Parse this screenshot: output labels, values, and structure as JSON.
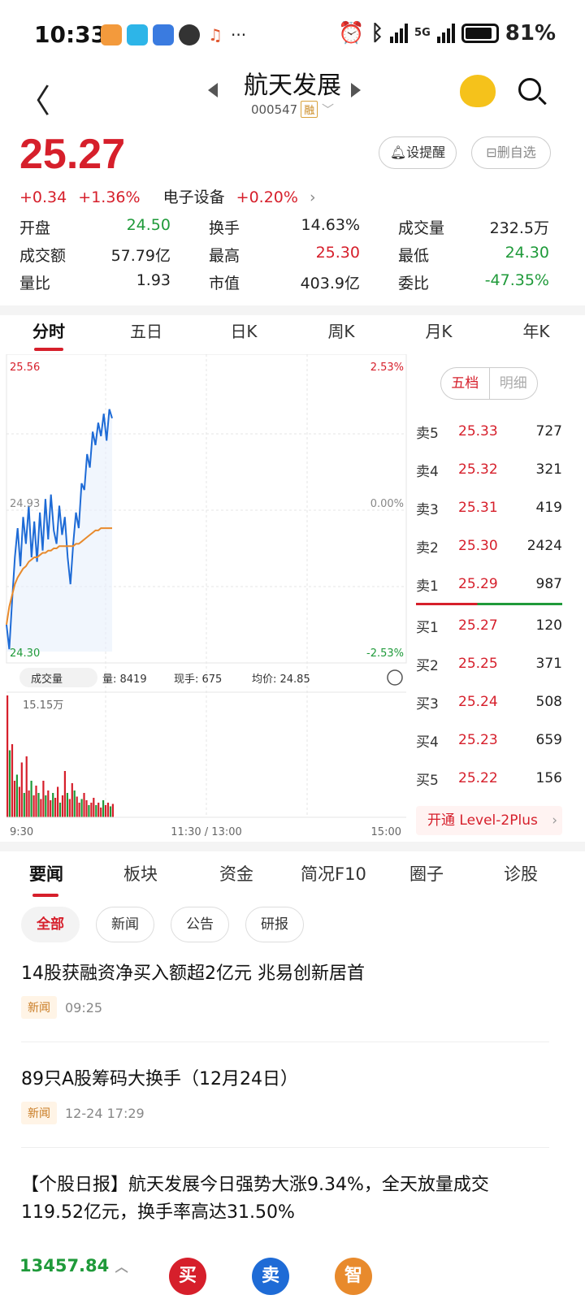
{
  "status": {
    "time": "10:33",
    "battery": "81%",
    "net": "5G"
  },
  "header": {
    "title": "航天发展",
    "code": "000547",
    "tag": "融"
  },
  "quote": {
    "price": "25.27",
    "change": "+0.34",
    "change_pct": "+1.36%",
    "sector": "电子设备",
    "sector_pct": "+0.20%",
    "remind": "设提醒",
    "unwatch": "删自选",
    "stats": [
      [
        {
          "l": "开盘",
          "v": "24.50",
          "c": "green"
        },
        {
          "l": "换手",
          "v": "14.63%",
          "c": ""
        },
        {
          "l": "成交量",
          "v": "232.5万",
          "c": ""
        }
      ],
      [
        {
          "l": "成交额",
          "v": "57.79亿",
          "c": ""
        },
        {
          "l": "最高",
          "v": "25.30",
          "c": "red"
        },
        {
          "l": "最低",
          "v": "24.30",
          "c": "green"
        }
      ],
      [
        {
          "l": "量比",
          "v": "1.93",
          "c": ""
        },
        {
          "l": "市值",
          "v": "403.9亿",
          "c": ""
        },
        {
          "l": "委比",
          "v": "-47.35%",
          "c": "green"
        }
      ]
    ]
  },
  "chart_tabs": [
    "分时",
    "五日",
    "日K",
    "周K",
    "月K",
    "年K"
  ],
  "chart": {
    "price_high": "25.56",
    "price_mid": "24.93",
    "price_low": "24.30",
    "pct_high": "2.53%",
    "pct_mid": "0.00%",
    "pct_low": "-2.53%",
    "vol_label": "成交量",
    "vol_info": "量: 8419",
    "now_hand": "现手: 675",
    "avg": "均价: 24.85",
    "vol_max": "15.15万",
    "time_start": "9:30",
    "time_mid": "11:30 / 13:00",
    "time_end": "15:00",
    "colors": {
      "price": "#1e6bd6",
      "avg": "#e88a2c",
      "up": "#d61f2b",
      "down": "#1f9a3a"
    }
  },
  "chart_data": {
    "type": "line",
    "ylim": [
      24.3,
      25.56
    ],
    "series": [
      {
        "values": [
          24.42,
          24.31,
          24.52,
          24.72,
          24.85,
          24.68,
          24.9,
          24.78,
          24.95,
          24.72,
          24.88,
          24.7,
          24.92,
          24.75,
          24.98,
          24.8,
          25.0,
          24.84,
          24.78,
          24.95,
          24.82,
          24.9,
          24.72,
          24.6,
          24.78,
          24.92,
          24.85,
          25.05,
          25.02,
          25.18,
          25.12,
          25.28,
          25.22,
          25.32,
          25.26,
          25.36,
          25.24,
          25.38,
          25.34
        ]
      },
      {
        "values": [
          24.42,
          24.5,
          24.55,
          24.6,
          24.63,
          24.65,
          24.67,
          24.68,
          24.7,
          24.71,
          24.72,
          24.72,
          24.73,
          24.74,
          24.74,
          24.75,
          24.75,
          24.76,
          24.76,
          24.77,
          24.77,
          24.77,
          24.77,
          24.77,
          24.77,
          24.78,
          24.78,
          24.79,
          24.8,
          24.81,
          24.82,
          24.83,
          24.84,
          24.84,
          24.85,
          24.85,
          24.85,
          24.85,
          24.85
        ]
      }
    ],
    "volume_pct": [
      1.0,
      0.55,
      0.6,
      0.3,
      0.35,
      0.25,
      0.45,
      0.2,
      0.5,
      0.22,
      0.3,
      0.18,
      0.26,
      0.2,
      0.15,
      0.3,
      0.18,
      0.22,
      0.14,
      0.2,
      0.16,
      0.25,
      0.12,
      0.18,
      0.38,
      0.2,
      0.15,
      0.28,
      0.22,
      0.17,
      0.12,
      0.15,
      0.2,
      0.14,
      0.1,
      0.12,
      0.16,
      0.1,
      0.12,
      0.08,
      0.14,
      0.1,
      0.12,
      0.09,
      0.11
    ]
  },
  "book": {
    "tab_on": "五档",
    "tab_off": "明细",
    "asks": [
      {
        "l": "卖5",
        "p": "25.33",
        "v": "727"
      },
      {
        "l": "卖4",
        "p": "25.32",
        "v": "321"
      },
      {
        "l": "卖3",
        "p": "25.31",
        "v": "419"
      },
      {
        "l": "卖2",
        "p": "25.30",
        "v": "2424"
      },
      {
        "l": "卖1",
        "p": "25.29",
        "v": "987"
      }
    ],
    "bids": [
      {
        "l": "买1",
        "p": "25.27",
        "v": "120"
      },
      {
        "l": "买2",
        "p": "25.25",
        "v": "371"
      },
      {
        "l": "买3",
        "p": "25.24",
        "v": "508"
      },
      {
        "l": "买4",
        "p": "25.23",
        "v": "659"
      },
      {
        "l": "买5",
        "p": "25.22",
        "v": "156"
      }
    ],
    "level2": "开通 Level-2Plus"
  },
  "news_tabs": [
    "要闻",
    "板块",
    "资金",
    "简况F10",
    "圈子",
    "诊股"
  ],
  "chips": [
    "全部",
    "新闻",
    "公告",
    "研报"
  ],
  "news": [
    {
      "title": "14股获融资净买入额超2亿元 兆易创新居首",
      "src": "新闻",
      "time": "09:25"
    },
    {
      "title": "89只A股筹码大换手（12月24日）",
      "src": "新闻",
      "time": "12-24 17:29"
    },
    {
      "title": "【个股日报】航天发展今日强势大涨9.34%，全天放量成交119.52亿元，换手率高达31.50%",
      "src": "",
      "time": ""
    }
  ],
  "bottom": {
    "index": "13457.84",
    "b1": "买",
    "b2": "卖",
    "b3": "智"
  }
}
